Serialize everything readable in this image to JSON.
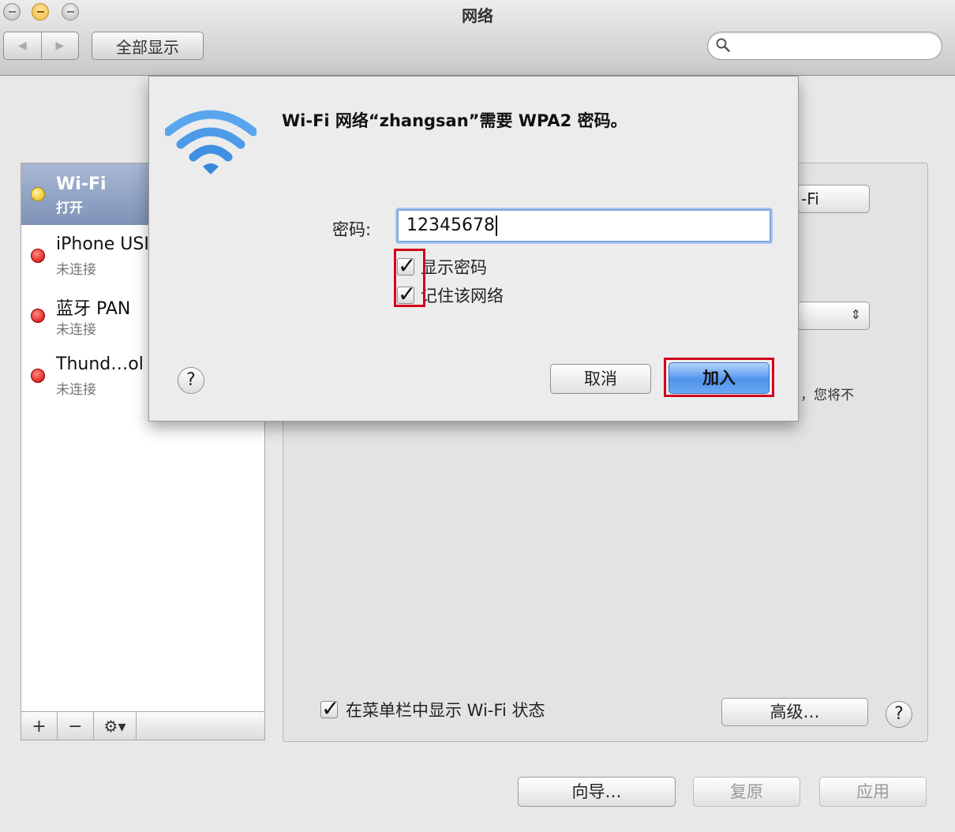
{
  "window": {
    "title": "网络"
  },
  "toolbar": {
    "back_glyph": "◀",
    "forward_glyph": "▶",
    "show_all_label": "全部显示",
    "search_placeholder": ""
  },
  "sidebar": {
    "items": [
      {
        "name": "Wi-Fi",
        "status": "打开",
        "color": "yellow",
        "selected": true
      },
      {
        "name": "iPhone USI",
        "status": "未连接",
        "color": "red"
      },
      {
        "name": "蓝牙 PAN",
        "status": "未连接",
        "color": "red"
      },
      {
        "name": "Thund…ol",
        "status": "未连接",
        "color": "red"
      }
    ],
    "add_glyph": "+",
    "remove_glyph": "−",
    "gear_glyph": "⚙▾"
  },
  "main": {
    "partial_button": "-Fi",
    "partial_text": "，您将不",
    "show_wifi_status_label": "在菜单栏中显示 Wi-Fi 状态",
    "show_wifi_status_checked": true,
    "advanced_label": "高级…",
    "help_glyph": "?"
  },
  "footer": {
    "assist_label": "向导…",
    "revert_label": "复原",
    "apply_label": "应用"
  },
  "dialog": {
    "title": "Wi-Fi 网络“zhangsan”需要 WPA2 密码。",
    "password_label": "密码:",
    "password_value": "12345678",
    "show_password_label": "显示密码",
    "show_password_checked": true,
    "remember_network_label": "记住该网络",
    "remember_network_checked": true,
    "cancel_label": "取消",
    "join_label": "加入",
    "help_glyph": "?",
    "tick_glyph": "✓"
  },
  "colors": {
    "highlight": "#d0021b",
    "selection": "#8a9cbf",
    "default_button": "#4f94ec",
    "wifi_icon": "#4a9be8"
  }
}
